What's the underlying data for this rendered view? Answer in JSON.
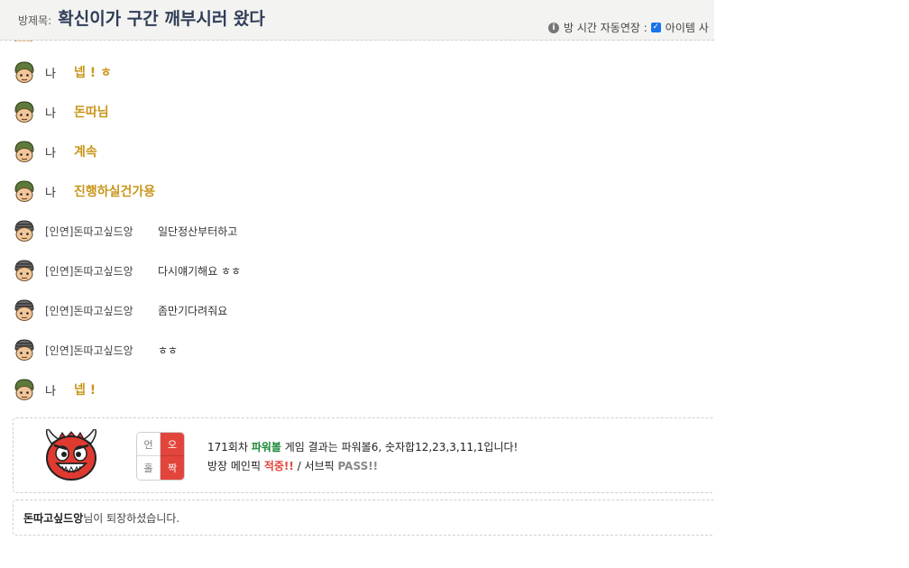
{
  "header": {
    "title_label": "방제목:",
    "title": "확신이가 구간 깨부시러 왔다",
    "room_time_label": "방 시간 자동연장 :",
    "item_label": "아이템 사"
  },
  "messages": [
    {
      "kind": "me",
      "sender": "나",
      "text": "넵 ! ㅎ"
    },
    {
      "kind": "me",
      "sender": "나",
      "text": "돈따님"
    },
    {
      "kind": "me",
      "sender": "나",
      "text": "계속"
    },
    {
      "kind": "me",
      "sender": "나",
      "text": "진행하실건가용"
    },
    {
      "kind": "other",
      "sender": "[인연]돈따고싶드앙",
      "text": "일단정산부터하고"
    },
    {
      "kind": "other",
      "sender": "[인연]돈따고싶드앙",
      "text": "다시얘기해요 ㅎㅎ"
    },
    {
      "kind": "other",
      "sender": "[인연]돈따고싶드앙",
      "text": "좀만기다려줘요"
    },
    {
      "kind": "other",
      "sender": "[인연]돈따고싶드앙",
      "text": "ㅎㅎ"
    },
    {
      "kind": "me",
      "sender": "나",
      "text": "넵 !"
    }
  ],
  "result": {
    "grid": {
      "r1c1": "언",
      "r1c2": "오",
      "r2c1": "홀",
      "r2c2": "짝"
    },
    "line1_a": "171회차 ",
    "line1_game": "파워볼",
    "line1_b": " 게임 결과는 파워볼6, 숫자합12,23,3,11,1입니다!",
    "line2_a": "방장 메인픽 ",
    "line2_hit": "적중!!",
    "line2_b": " / 서브픽 ",
    "line2_pass": "PASS!!"
  },
  "notice": {
    "name": "돈따고싶드앙",
    "text": "님이 퇴장하셨습니다."
  },
  "colors": {
    "me_text": "#c9961a",
    "game_name": "#1e8a3a",
    "hit": "#e2453c",
    "pass": "#888888",
    "header_bg": "#f3f3f1"
  }
}
